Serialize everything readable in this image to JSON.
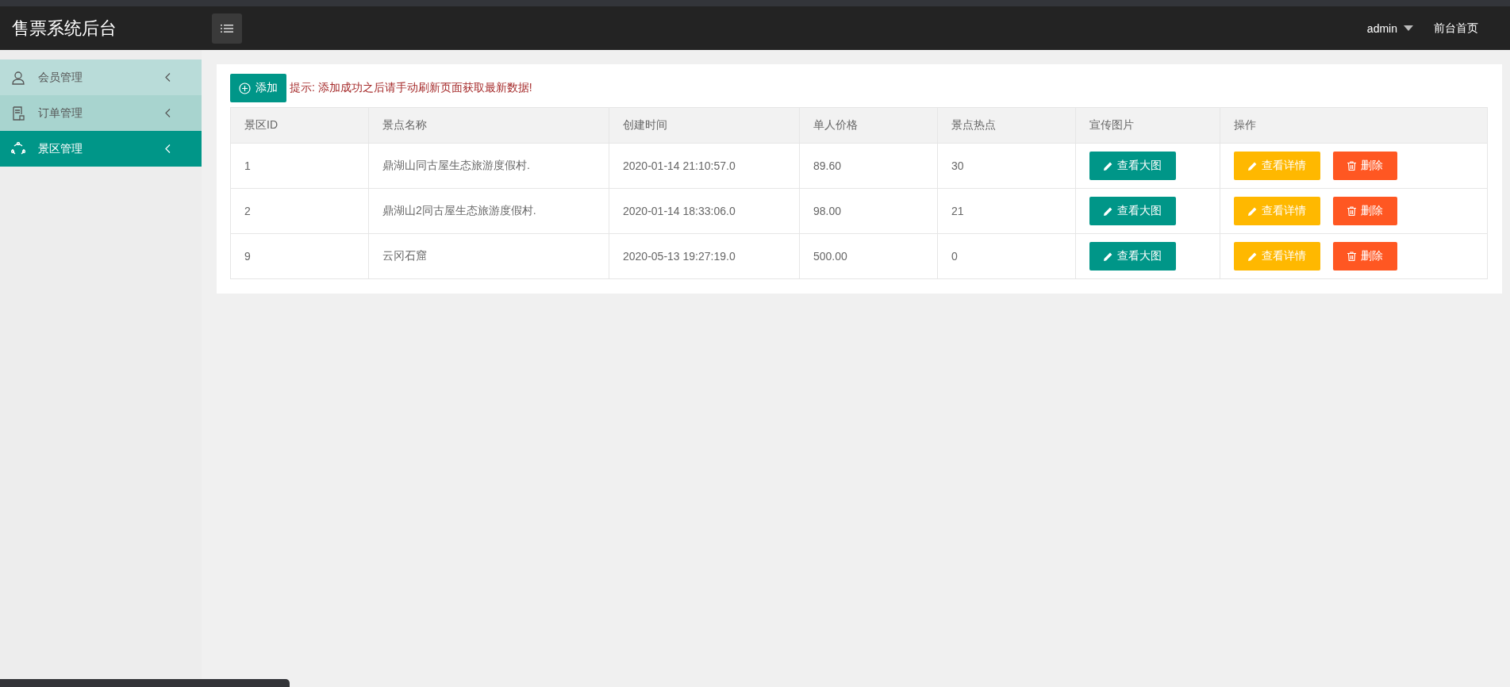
{
  "header": {
    "title": "售票系统后台",
    "user": "admin",
    "home_link": "前台首页"
  },
  "sidebar": {
    "items": [
      {
        "label": "会员管理",
        "kind": "user",
        "selected": false
      },
      {
        "label": "订单管理",
        "kind": "order",
        "selected": false
      },
      {
        "label": "景区管理",
        "kind": "scenic",
        "selected": true
      }
    ]
  },
  "toolbar": {
    "add_button": "添加",
    "tip": "提示: 添加成功之后请手动刷新页面获取最新数据!"
  },
  "table": {
    "columns": [
      "景区ID",
      "景点名称",
      "创建时间",
      "单人价格",
      "景点热点",
      "宣传图片",
      "操作"
    ],
    "rows": [
      {
        "cells": [
          "1",
          "鼎湖山同古屋生态旅游度假村.",
          "2020-01-14 21:10:57.0",
          "89.60",
          "30"
        ],
        "image_button": "查看大图",
        "actions": [
          {
            "kind": "detail",
            "label": "查看详情"
          },
          {
            "kind": "delete",
            "label": "删除"
          }
        ]
      },
      {
        "cells": [
          "2",
          "鼎湖山2同古屋生态旅游度假村.",
          "2020-01-14 18:33:06.0",
          "98.00",
          "21"
        ],
        "image_button": "查看大图",
        "actions": [
          {
            "kind": "detail",
            "label": "查看详情"
          },
          {
            "kind": "delete",
            "label": "删除"
          }
        ]
      },
      {
        "cells": [
          "9",
          "云冈石窟",
          "2020-05-13 19:27:19.0",
          "500.00",
          "0"
        ],
        "image_button": "查看大图",
        "actions": [
          {
            "kind": "detail",
            "label": "查看详情"
          },
          {
            "kind": "delete",
            "label": "删除"
          }
        ]
      }
    ]
  }
}
